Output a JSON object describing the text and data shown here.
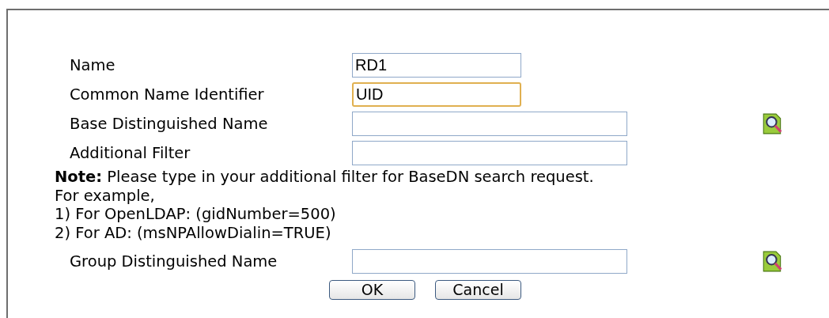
{
  "fields_top": [
    {
      "label": "Name",
      "value": "RD1",
      "kind": "short",
      "focused": false,
      "lookup": false
    },
    {
      "label": "Common Name Identifier",
      "value": "UID",
      "kind": "short",
      "focused": true,
      "lookup": false
    },
    {
      "label": "Base Distinguished Name",
      "kind": "long",
      "focused": false,
      "lookup": true
    },
    {
      "label": "Additional Filter",
      "kind": "long",
      "focused": false,
      "lookup": false
    }
  ],
  "note": [
    "**Note:** Please type in your additional filter for BaseDN search request.",
    "For example,",
    "1) For OpenLDAP: (gidNumber=500)",
    "2) For AD: (msNPAllowDialin=TRUE)"
  ],
  "fields_bottom": [
    {
      "label": "Group Distinguished Name",
      "kind": "long",
      "focused": false,
      "lookup": true
    }
  ],
  "buttons": [
    "OK",
    "Cancel"
  ]
}
